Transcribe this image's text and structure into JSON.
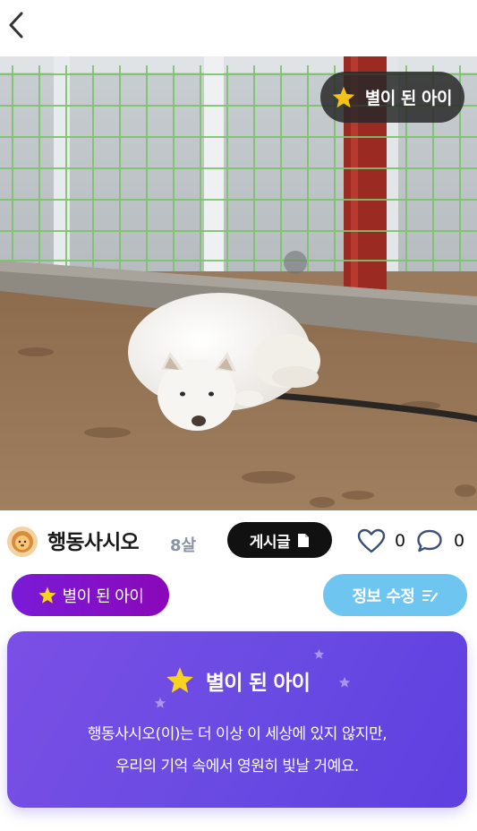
{
  "header": {
    "back_icon": "chevron-left-icon"
  },
  "photo": {
    "badge_label": "별이 된 아이",
    "badge_icon": "star-icon"
  },
  "profile": {
    "name": "행동사시오",
    "age": "8살",
    "avatar_icon": "lion-avatar-icon",
    "posts_label": "게시글",
    "posts_icon": "document-icon",
    "like_count": "0",
    "comment_count": "0"
  },
  "actions": {
    "status_label": "별이 된 아이",
    "edit_label": "정보 수정",
    "edit_icon": "edit-list-icon"
  },
  "memorial": {
    "title": "별이 된 아이",
    "line1": "행동사시오(이)는 더 이상 이 세상에 있지 않지만,",
    "line2": "우리의 기억 속에서 영원히 빛날 거예요."
  },
  "colors": {
    "status_pill": "#7a1bd8",
    "edit_pill": "#6ec6f0",
    "card_gradient_start": "#7b4fe6",
    "card_gradient_end": "#5f3fe0",
    "star": "#f7d21e"
  }
}
